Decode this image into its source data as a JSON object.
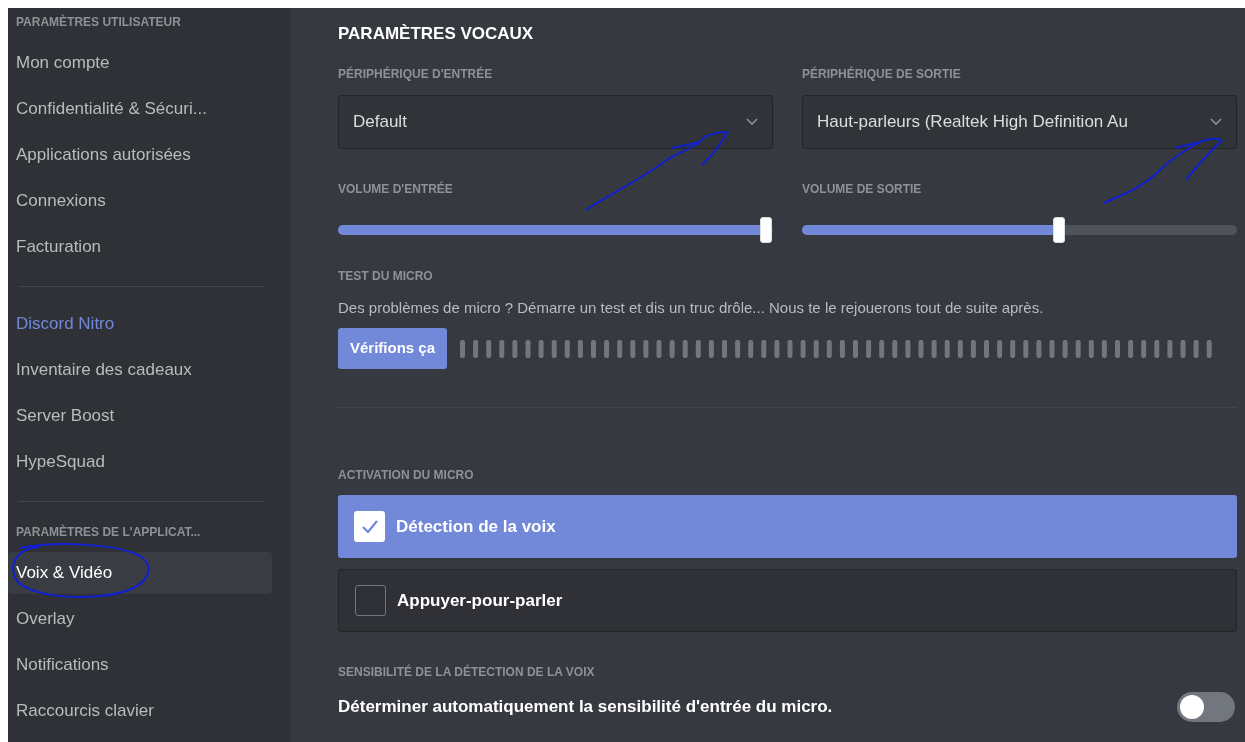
{
  "sidebar": {
    "sections": [
      {
        "header": "PARAMÈTRES UTILISATEUR",
        "items": [
          {
            "label": "Mon compte",
            "selected": false,
            "kind": "plain"
          },
          {
            "label": "Confidentialité & Sécuri...",
            "selected": false,
            "kind": "plain"
          },
          {
            "label": "Applications autorisées",
            "selected": false,
            "kind": "plain"
          },
          {
            "label": "Connexions",
            "selected": false,
            "kind": "plain"
          },
          {
            "label": "Facturation",
            "selected": false,
            "kind": "plain"
          }
        ]
      },
      {
        "items": [
          {
            "label": "Discord Nitro",
            "selected": false,
            "kind": "accent"
          },
          {
            "label": "Inventaire des cadeaux",
            "selected": false,
            "kind": "plain"
          },
          {
            "label": "Server Boost",
            "selected": false,
            "kind": "plain"
          },
          {
            "label": "HypeSquad",
            "selected": false,
            "kind": "plain"
          }
        ]
      },
      {
        "header": "PARAMÈTRES DE L'APPLICAT...",
        "items": [
          {
            "label": "Voix & Vidéo",
            "selected": true,
            "kind": "plain"
          },
          {
            "label": "Overlay",
            "selected": false,
            "kind": "plain"
          },
          {
            "label": "Notifications",
            "selected": false,
            "kind": "plain"
          },
          {
            "label": "Raccourcis clavier",
            "selected": false,
            "kind": "plain"
          }
        ]
      }
    ]
  },
  "main": {
    "title": "PARAMÈTRES VOCAUX",
    "devices": [
      {
        "label": "PÉRIPHÉRIQUE D'ENTRÉE",
        "value": "Default",
        "volume_label": "VOLUME D'ENTRÉE",
        "level": 0.985
      },
      {
        "label": "PÉRIPHÉRIQUE DE SORTIE",
        "value": "Haut-parleurs (Realtek High Definition Au",
        "volume_label": "VOLUME DE SORTIE",
        "level": 0.59
      }
    ],
    "mic_test": {
      "label": "TEST DU MICRO",
      "description": "Des problèmes de micro ? Démarre un test et dis un truc drôle... Nous te le rejouerons tout de suite après.",
      "button": "Vérifions ça"
    },
    "activation": {
      "label": "ACTIVATION DU MICRO",
      "options": [
        {
          "label": "Détection de la voix",
          "selected": true
        },
        {
          "label": "Appuyer-pour-parler",
          "selected": false
        }
      ]
    },
    "sensitivity": {
      "label": "SENSIBILITÉ DE LA DÉTECTION DE LA VOIX",
      "text": "Déterminer automatiquement la sensibilité d'entrée du micro.",
      "on": false
    }
  }
}
